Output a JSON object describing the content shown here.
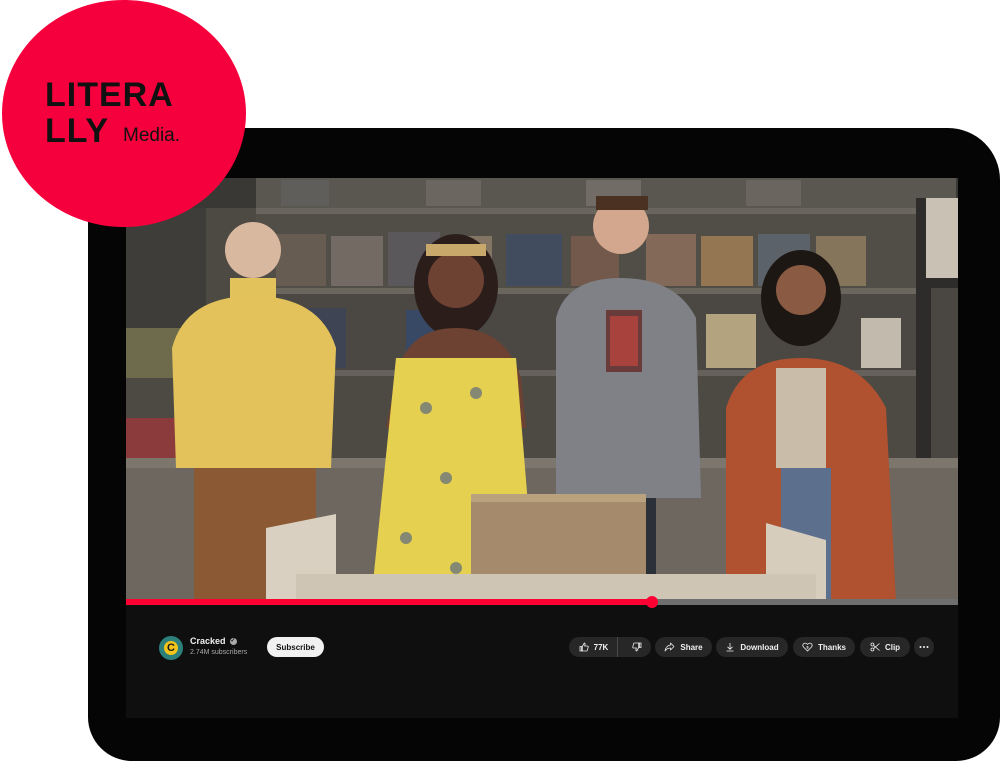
{
  "brand": {
    "logo_line1": "LITERA",
    "logo_line2": "LLY",
    "logo_sub": "Media.",
    "logo_color": "#f5003c"
  },
  "player": {
    "progress_fraction": 0.632,
    "progress_color": "#ff0033"
  },
  "channel": {
    "avatar_glyph": "C",
    "name": "Cracked",
    "verified_icon": "verified-check-icon",
    "subscribers": "2.74M subscribers",
    "subscribe_label": "Subscribe"
  },
  "actions": {
    "like_count": "77K",
    "like_icon": "thumbs-up-icon",
    "dislike_icon": "thumbs-down-icon",
    "share_label": "Share",
    "share_icon": "share-arrow-icon",
    "download_label": "Download",
    "download_icon": "download-icon",
    "thanks_label": "Thanks",
    "thanks_icon": "thanks-heart-icon",
    "clip_label": "Clip",
    "clip_icon": "scissors-icon",
    "more_icon": "more-dots-icon"
  }
}
